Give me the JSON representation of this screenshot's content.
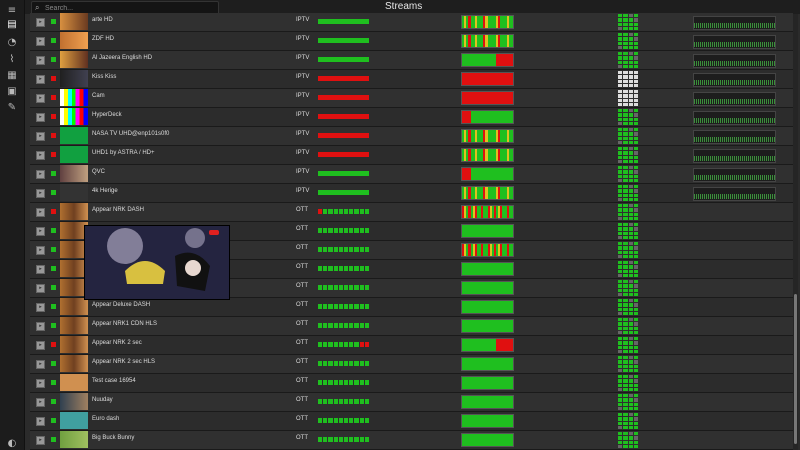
{
  "header": {
    "title": "Streams"
  },
  "search": {
    "placeholder": "Search..."
  },
  "sidebar": {
    "icons": [
      "menu-icon",
      "streams-icon",
      "alarm-icon",
      "chart-icon",
      "grid-icon",
      "image-icon",
      "wrench-icon",
      "theme-icon"
    ]
  },
  "colors": {
    "ok": "#1fbf1f",
    "error": "#e01010",
    "warn": "#e0c020"
  },
  "rows": [
    {
      "name": "arte HD",
      "type": "IPTV",
      "status": "ok",
      "bar": "ok",
      "wide": "mixed_ok",
      "thumb": "arte"
    },
    {
      "name": "ZDF HD",
      "type": "IPTV",
      "status": "ok",
      "bar": "ok",
      "wide": "mixed_ok",
      "thumb": "zdf"
    },
    {
      "name": "Al Jazeera English HD",
      "type": "IPTV",
      "status": "ok",
      "bar": "ok",
      "wide": "ok_red",
      "thumb": "aljazeera"
    },
    {
      "name": "Kiss Kiss",
      "type": "IPTV",
      "status": "error",
      "bar": "error",
      "wide": "error",
      "thumb": "kiss"
    },
    {
      "name": "Cam",
      "type": "IPTV",
      "status": "error",
      "bar": "error",
      "wide": "error",
      "thumb": "bars"
    },
    {
      "name": "HyperDeck",
      "type": "IPTV",
      "status": "error",
      "bar": "error",
      "wide": "red_ok",
      "thumb": "bars"
    },
    {
      "name": "NASA TV UHD@enp101s0f0",
      "type": "IPTV",
      "status": "error",
      "bar": "error",
      "wide": "mixed_ok",
      "thumb": "scr"
    },
    {
      "name": "UHD1 by ASTRA / HD+",
      "type": "IPTV",
      "status": "error",
      "bar": "error",
      "wide": "mixed_ok",
      "thumb": "scr"
    },
    {
      "name": "QVC",
      "type": "IPTV",
      "status": "ok",
      "bar": "ok",
      "wide": "red_ok",
      "thumb": "qvc"
    },
    {
      "name": "4k Herige",
      "type": "IPTV",
      "status": "ok",
      "bar": "ok",
      "wide": "mixed_ok",
      "thumb": "dark"
    },
    {
      "name": "Appear NRK DASH",
      "type": "OTT",
      "status": "error",
      "bar": "seg_red",
      "wide": "mixed",
      "thumb": "stage"
    },
    {
      "name": "",
      "type": "OTT",
      "status": "ok",
      "bar": "seg",
      "wide": "ok",
      "thumb": "stage"
    },
    {
      "name": "",
      "type": "OTT",
      "status": "ok",
      "bar": "seg",
      "wide": "mixed",
      "thumb": "stage"
    },
    {
      "name": "",
      "type": "OTT",
      "status": "ok",
      "bar": "seg",
      "wide": "ok",
      "thumb": "stage"
    },
    {
      "name": "",
      "type": "OTT",
      "status": "ok",
      "bar": "seg",
      "wide": "ok",
      "thumb": "stage"
    },
    {
      "name": "Appear Deluxe DASH",
      "type": "OTT",
      "status": "ok",
      "bar": "seg",
      "wide": "ok",
      "thumb": "stage"
    },
    {
      "name": "Appear NRK1 CDN HLS",
      "type": "OTT",
      "status": "ok",
      "bar": "seg",
      "wide": "ok",
      "thumb": "stage"
    },
    {
      "name": "Appear NRK 2 sec",
      "type": "OTT",
      "status": "error",
      "bar": "seg_end_red",
      "wide": "ok_red",
      "thumb": "stage"
    },
    {
      "name": "Appear NRK 2 sec HLS",
      "type": "OTT",
      "status": "ok",
      "bar": "seg",
      "wide": "ok",
      "thumb": "stage"
    },
    {
      "name": "Test case 16954",
      "type": "OTT",
      "status": "ok",
      "bar": "seg",
      "wide": "ok",
      "thumb": "hls"
    },
    {
      "name": "Nuuday",
      "type": "OTT",
      "status": "ok",
      "bar": "seg",
      "wide": "ok",
      "thumb": "nuuday"
    },
    {
      "name": "Euro dash",
      "type": "OTT",
      "status": "ok",
      "bar": "seg",
      "wide": "ok",
      "thumb": "dash"
    },
    {
      "name": "Big Buck Bunny",
      "type": "OTT",
      "status": "ok",
      "bar": "seg",
      "wide": "ok",
      "thumb": "bunny"
    }
  ]
}
